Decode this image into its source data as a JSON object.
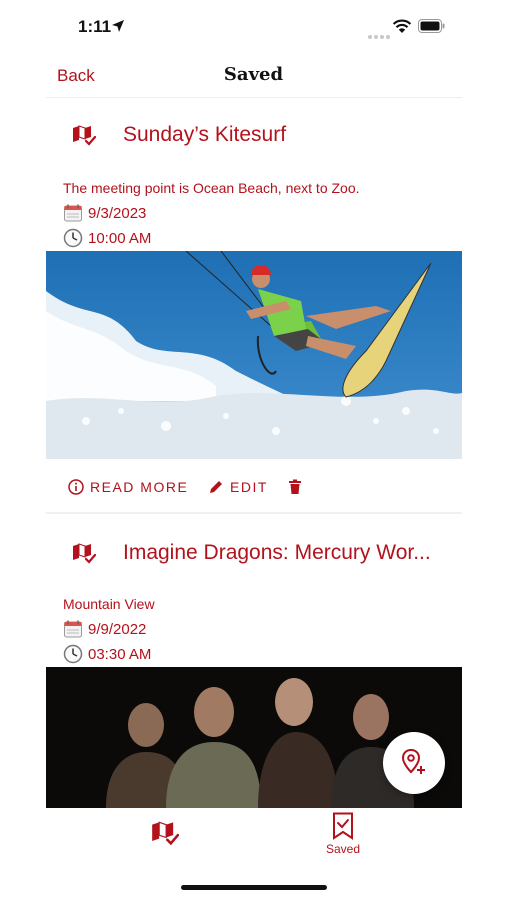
{
  "status_bar": {
    "time": "1:11"
  },
  "nav": {
    "back_label": "Back",
    "title": "Saved"
  },
  "events": [
    {
      "title": "Sunday’s Kitesurf",
      "description": "The meeting point is Ocean Beach, next to Zoo.",
      "date": "9/3/2023",
      "time": "10:00 AM",
      "actions": {
        "read_more": "READ MORE",
        "edit": "EDIT"
      }
    },
    {
      "title": "Imagine Dragons: Mercury Wor...",
      "description": "Mountain View",
      "date": "9/9/2022",
      "time": "03:30 AM"
    }
  ],
  "tab_bar": {
    "saved_label": "Saved"
  },
  "colors": {
    "accent": "#b3121c",
    "text_dark": "#111111",
    "divider": "#eeeeee"
  }
}
